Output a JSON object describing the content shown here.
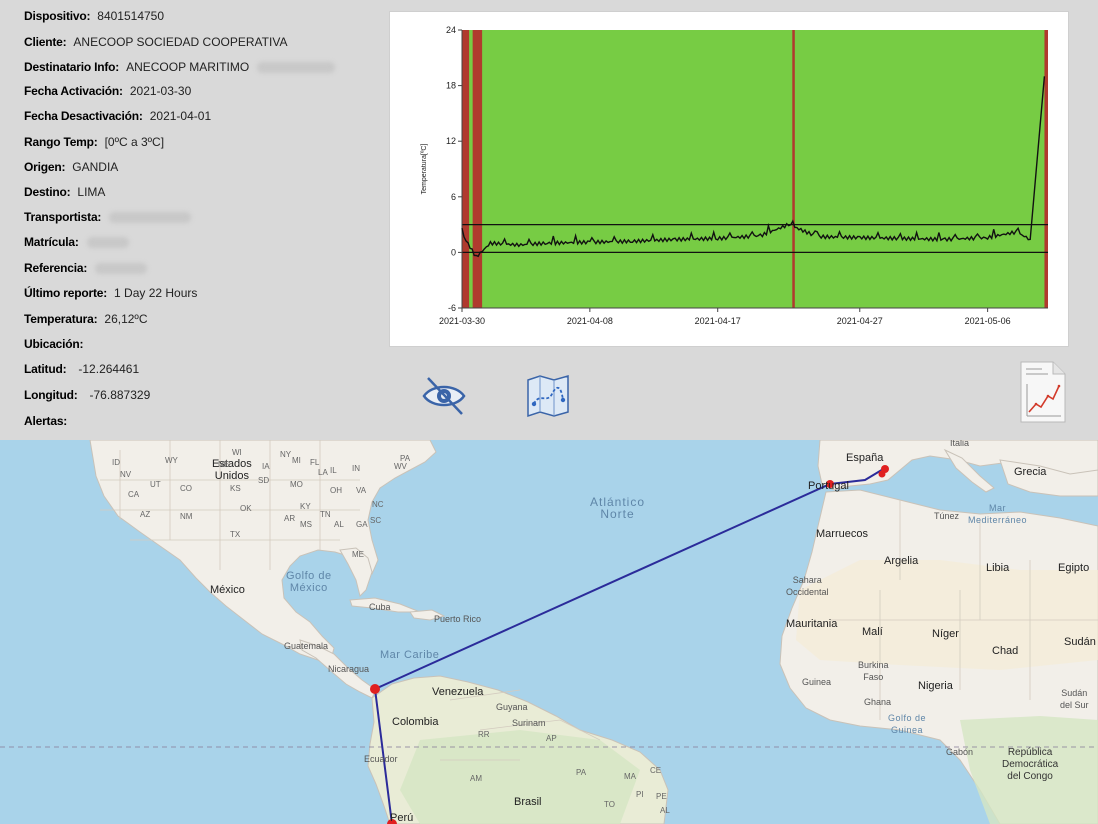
{
  "info": {
    "dispositivo": {
      "label": "Dispositivo:",
      "value": "8401514750"
    },
    "cliente": {
      "label": "Cliente:",
      "value": "ANECOOP SOCIEDAD COOPERATIVA"
    },
    "destinatario": {
      "label": "Destinatario Info:",
      "value": "ANECOOP MARITIMO"
    },
    "fecha_activacion": {
      "label": "Fecha Activación:",
      "value": "2021-03-30"
    },
    "fecha_desactivacion": {
      "label": "Fecha Desactivación:",
      "value": "2021-04-01"
    },
    "rango_temp": {
      "label": "Rango Temp:",
      "value": "[0ºC a 3ºC]"
    },
    "origen": {
      "label": "Origen:",
      "value": "GANDIA"
    },
    "destino": {
      "label": "Destino:",
      "value": "LIMA"
    },
    "transportista": {
      "label": "Transportista:",
      "value": ""
    },
    "matricula": {
      "label": "Matrícula:",
      "value": ""
    },
    "referencia": {
      "label": "Referencia:",
      "value": ""
    },
    "ultimo_reporte": {
      "label": "Último reporte:",
      "value": "1 Day 22 Hours"
    },
    "temperatura": {
      "label": "Temperatura:",
      "value": "26,12ºC"
    },
    "ubicacion": {
      "label": "Ubicación:",
      "value": ""
    },
    "latitud": {
      "label": "Latitud:",
      "value": "-12.264461"
    },
    "longitud": {
      "label": "Longitud:",
      "value": "-76.887329"
    },
    "alertas": {
      "label": "Alertas:",
      "value": ""
    }
  },
  "chart_data": {
    "type": "line",
    "title": "",
    "xlabel": "",
    "ylabel": "Temperatura[ºC]",
    "ylim": [
      -6,
      24
    ],
    "yticks": [
      -6,
      0,
      6,
      12,
      18,
      24
    ],
    "xlim": [
      "2021-03-30",
      "2021-05-10"
    ],
    "xticks": [
      "2021-03-30",
      "2021-04-08",
      "2021-04-17",
      "2021-04-27",
      "2021-05-06"
    ],
    "threshold_lines": [
      0,
      3
    ],
    "in_range_color": "#77cc44",
    "alert_color": "#b03a2e",
    "alert_bands": [
      [
        "2021-03-30",
        "2021-03-30T12:00"
      ],
      [
        "2021-03-30T18:00",
        "2021-03-31T10:00"
      ],
      [
        "2021-04-22T06:00",
        "2021-04-22T10:00"
      ],
      [
        "2021-05-10T00:00",
        "2021-05-10T06:00"
      ]
    ],
    "series": [
      {
        "color": "#111111",
        "x": [
          "2021-03-30",
          "2021-03-31",
          "2021-04-01",
          "2021-04-03",
          "2021-04-05",
          "2021-04-08",
          "2021-04-11",
          "2021-04-14",
          "2021-04-17",
          "2021-04-20",
          "2021-04-22",
          "2021-04-24",
          "2021-04-27",
          "2021-04-30",
          "2021-05-03",
          "2021-05-06",
          "2021-05-08",
          "2021-05-09",
          "2021-05-10"
        ],
        "y": [
          2.0,
          -0.5,
          1.0,
          0.8,
          1.0,
          1.1,
          1.2,
          1.4,
          1.5,
          1.8,
          3.0,
          1.7,
          1.6,
          1.5,
          1.4,
          1.6,
          2.2,
          1.4,
          19.0
        ]
      }
    ]
  },
  "toolbar": {
    "hide_icon": "eye-slash-icon",
    "map_icon": "map-route-icon",
    "report_icon": "chart-report-icon"
  },
  "map": {
    "labels": {
      "usa": "Estados\nUnidos",
      "mexico": "México",
      "golfo_mexico": "Golfo de\nMéxico",
      "cuba": "Cuba",
      "puerto_rico": "Puerto Rico",
      "guatemala": "Guatemala",
      "nicaragua": "Nicaragua",
      "mar_caribe": "Mar Caribe",
      "venezuela": "Venezuela",
      "guyana": "Guyana",
      "surinam": "Surinam",
      "colombia": "Colombia",
      "ecuador": "Ecuador",
      "peru": "Perú",
      "brasil": "Brasil",
      "atlantico": "Atlántico\nNorte",
      "espana": "España",
      "portugal": "Portugal",
      "italia": "Italia",
      "grecia": "Grecia",
      "tunez": "Túnez",
      "mar_mediterraneo": "Mar\nMediterráneo",
      "marruecos": "Marruecos",
      "argelia": "Argelia",
      "libia": "Libia",
      "egipto": "Egipto",
      "sahara": "Sahara\nOccidental",
      "mauritania": "Mauritania",
      "mali": "Malí",
      "niger": "Níger",
      "chad": "Chad",
      "sudan": "Sudán",
      "sudan_sur": "Sudán\ndel Sur",
      "burkina": "Burkina\nFaso",
      "guinea": "Guinea",
      "ghana": "Ghana",
      "nigeria": "Nigeria",
      "golfo_guinea": "Golfo de\nGuinea",
      "gabon": "Gabón",
      "congo": "República\nDemocrática\ndel Congo",
      "am": "AM",
      "pa": "PA",
      "ap": "AP",
      "rr": "RR",
      "ma": "MA",
      "ce": "CE",
      "pi": "PI",
      "to": "TO",
      "pe": "PE",
      "al": "AL"
    },
    "states": [
      "ID",
      "WY",
      "NE",
      "IA",
      "NV",
      "UT",
      "CO",
      "KS",
      "MO",
      "CA",
      "AZ",
      "NM",
      "OK",
      "AR",
      "TX",
      "MS",
      "LA",
      "IL",
      "IN",
      "OH",
      "KY",
      "TN",
      "AL",
      "GA",
      "SC",
      "NC",
      "VA",
      "WV",
      "PA",
      "NY",
      "ME",
      "FL",
      "MI",
      "WI",
      "SD",
      "IA"
    ],
    "route_color": "#2b2b9a",
    "marker_color": "#e02020",
    "land_color": "#f2efe9",
    "water_color": "#a9d3ea"
  }
}
